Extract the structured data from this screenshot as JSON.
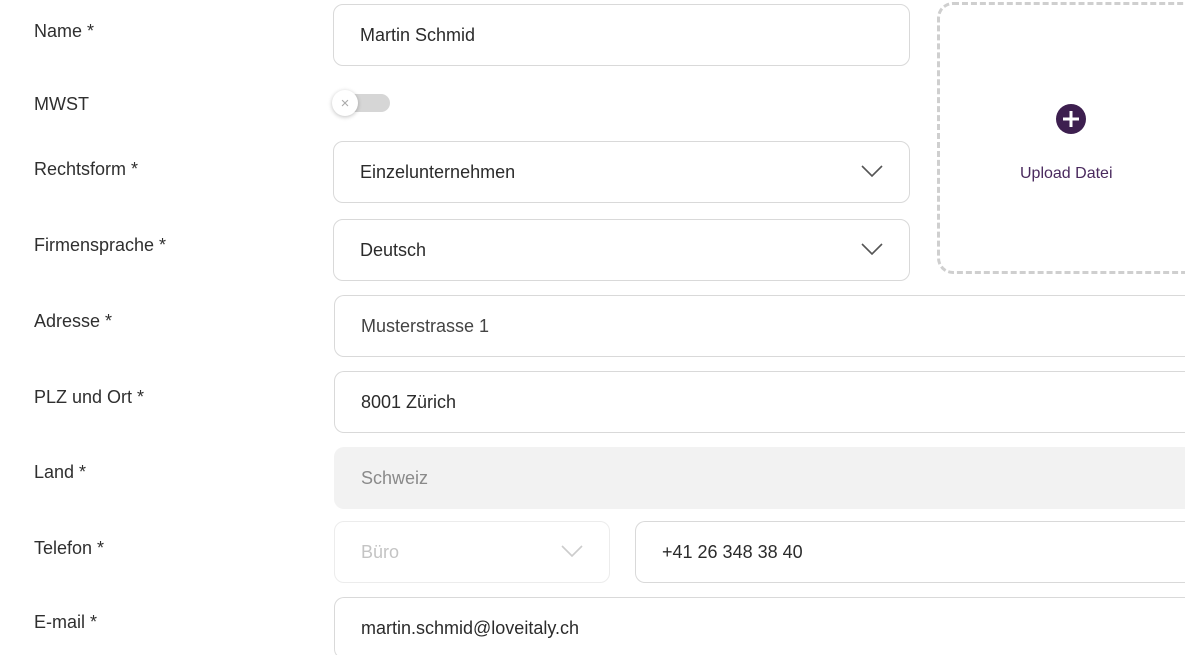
{
  "form": {
    "name": {
      "label": "Name *",
      "value": "Martin Schmid"
    },
    "mwst": {
      "label": "MWST",
      "toggle_icon": "×",
      "checked": false
    },
    "rechtsform": {
      "label": "Rechtsform *",
      "value": "Einzelunternehmen"
    },
    "firmensprache": {
      "label": "Firmensprache *",
      "value": "Deutsch"
    },
    "adresse": {
      "label": "Adresse *",
      "value": "Musterstrasse 1"
    },
    "plz_ort": {
      "label": "PLZ und Ort *",
      "value": "8001 Zürich"
    },
    "land": {
      "label": "Land *",
      "value": "Schweiz"
    },
    "telefon": {
      "label": "Telefon *",
      "type_value": "Büro",
      "number": "+41 26 348 38 40"
    },
    "email": {
      "label": "E-mail *",
      "value": "martin.schmid@loveitaly.ch"
    }
  },
  "upload": {
    "label": "Upload Datei",
    "icon": "plus-circle-icon"
  },
  "colors": {
    "accent": "#3d1f4f",
    "border": "#d9d9d9",
    "disabled_bg": "#f2f2f2",
    "toggle_off": "#d6d6d6"
  }
}
